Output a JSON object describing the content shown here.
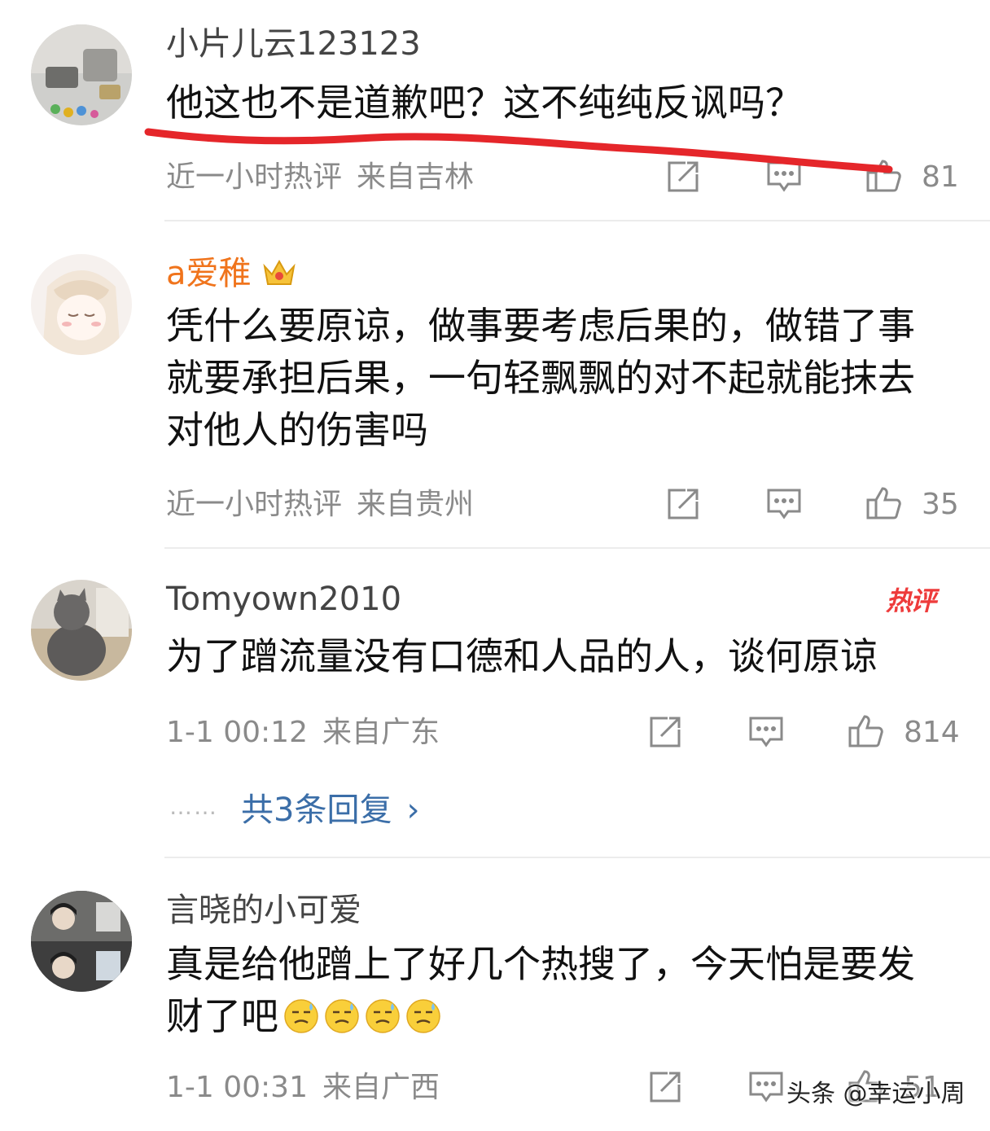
{
  "comments": [
    {
      "username": "小片儿云123123",
      "text": "他这也不是道歉吧？这不纯纯反讽吗？",
      "time": "近一小时热评",
      "location": "来自吉林",
      "likes": "81"
    },
    {
      "username": "a爱稚",
      "text": "凭什么要原谅，做事要考虑后果的，做错了事就要承担后果，一句轻飘飘的对不起就能抹去对他人的伤害吗",
      "time": "近一小时热评",
      "location": "来自贵州",
      "likes": "35"
    },
    {
      "username": "Tomyown2010",
      "badge": "热评",
      "text": "为了蹭流量没有口德和人品的人，谈何原谅",
      "time": "1-1 00:12",
      "location": "来自广东",
      "likes": "814",
      "replies": "共3条回复",
      "replies_dots": "……"
    },
    {
      "username": "言晓的小可爱",
      "text": "真是给他蹭上了好几个热搜了，今天怕是要发财了吧",
      "time": "1-1 00:31",
      "location": "来自广西",
      "likes": "51"
    }
  ],
  "watermark": "头条 @幸运小周",
  "colors": {
    "link": "#3b6ea8",
    "vip_name": "#f0741c",
    "hot_badge": "#ee3b3b",
    "highlight_stroke": "#e5262a"
  },
  "icons": [
    "share-icon",
    "comment-icon",
    "thumbs-up-icon",
    "crown-icon",
    "chevron-right-icon",
    "sweat-emoji-icon"
  ]
}
